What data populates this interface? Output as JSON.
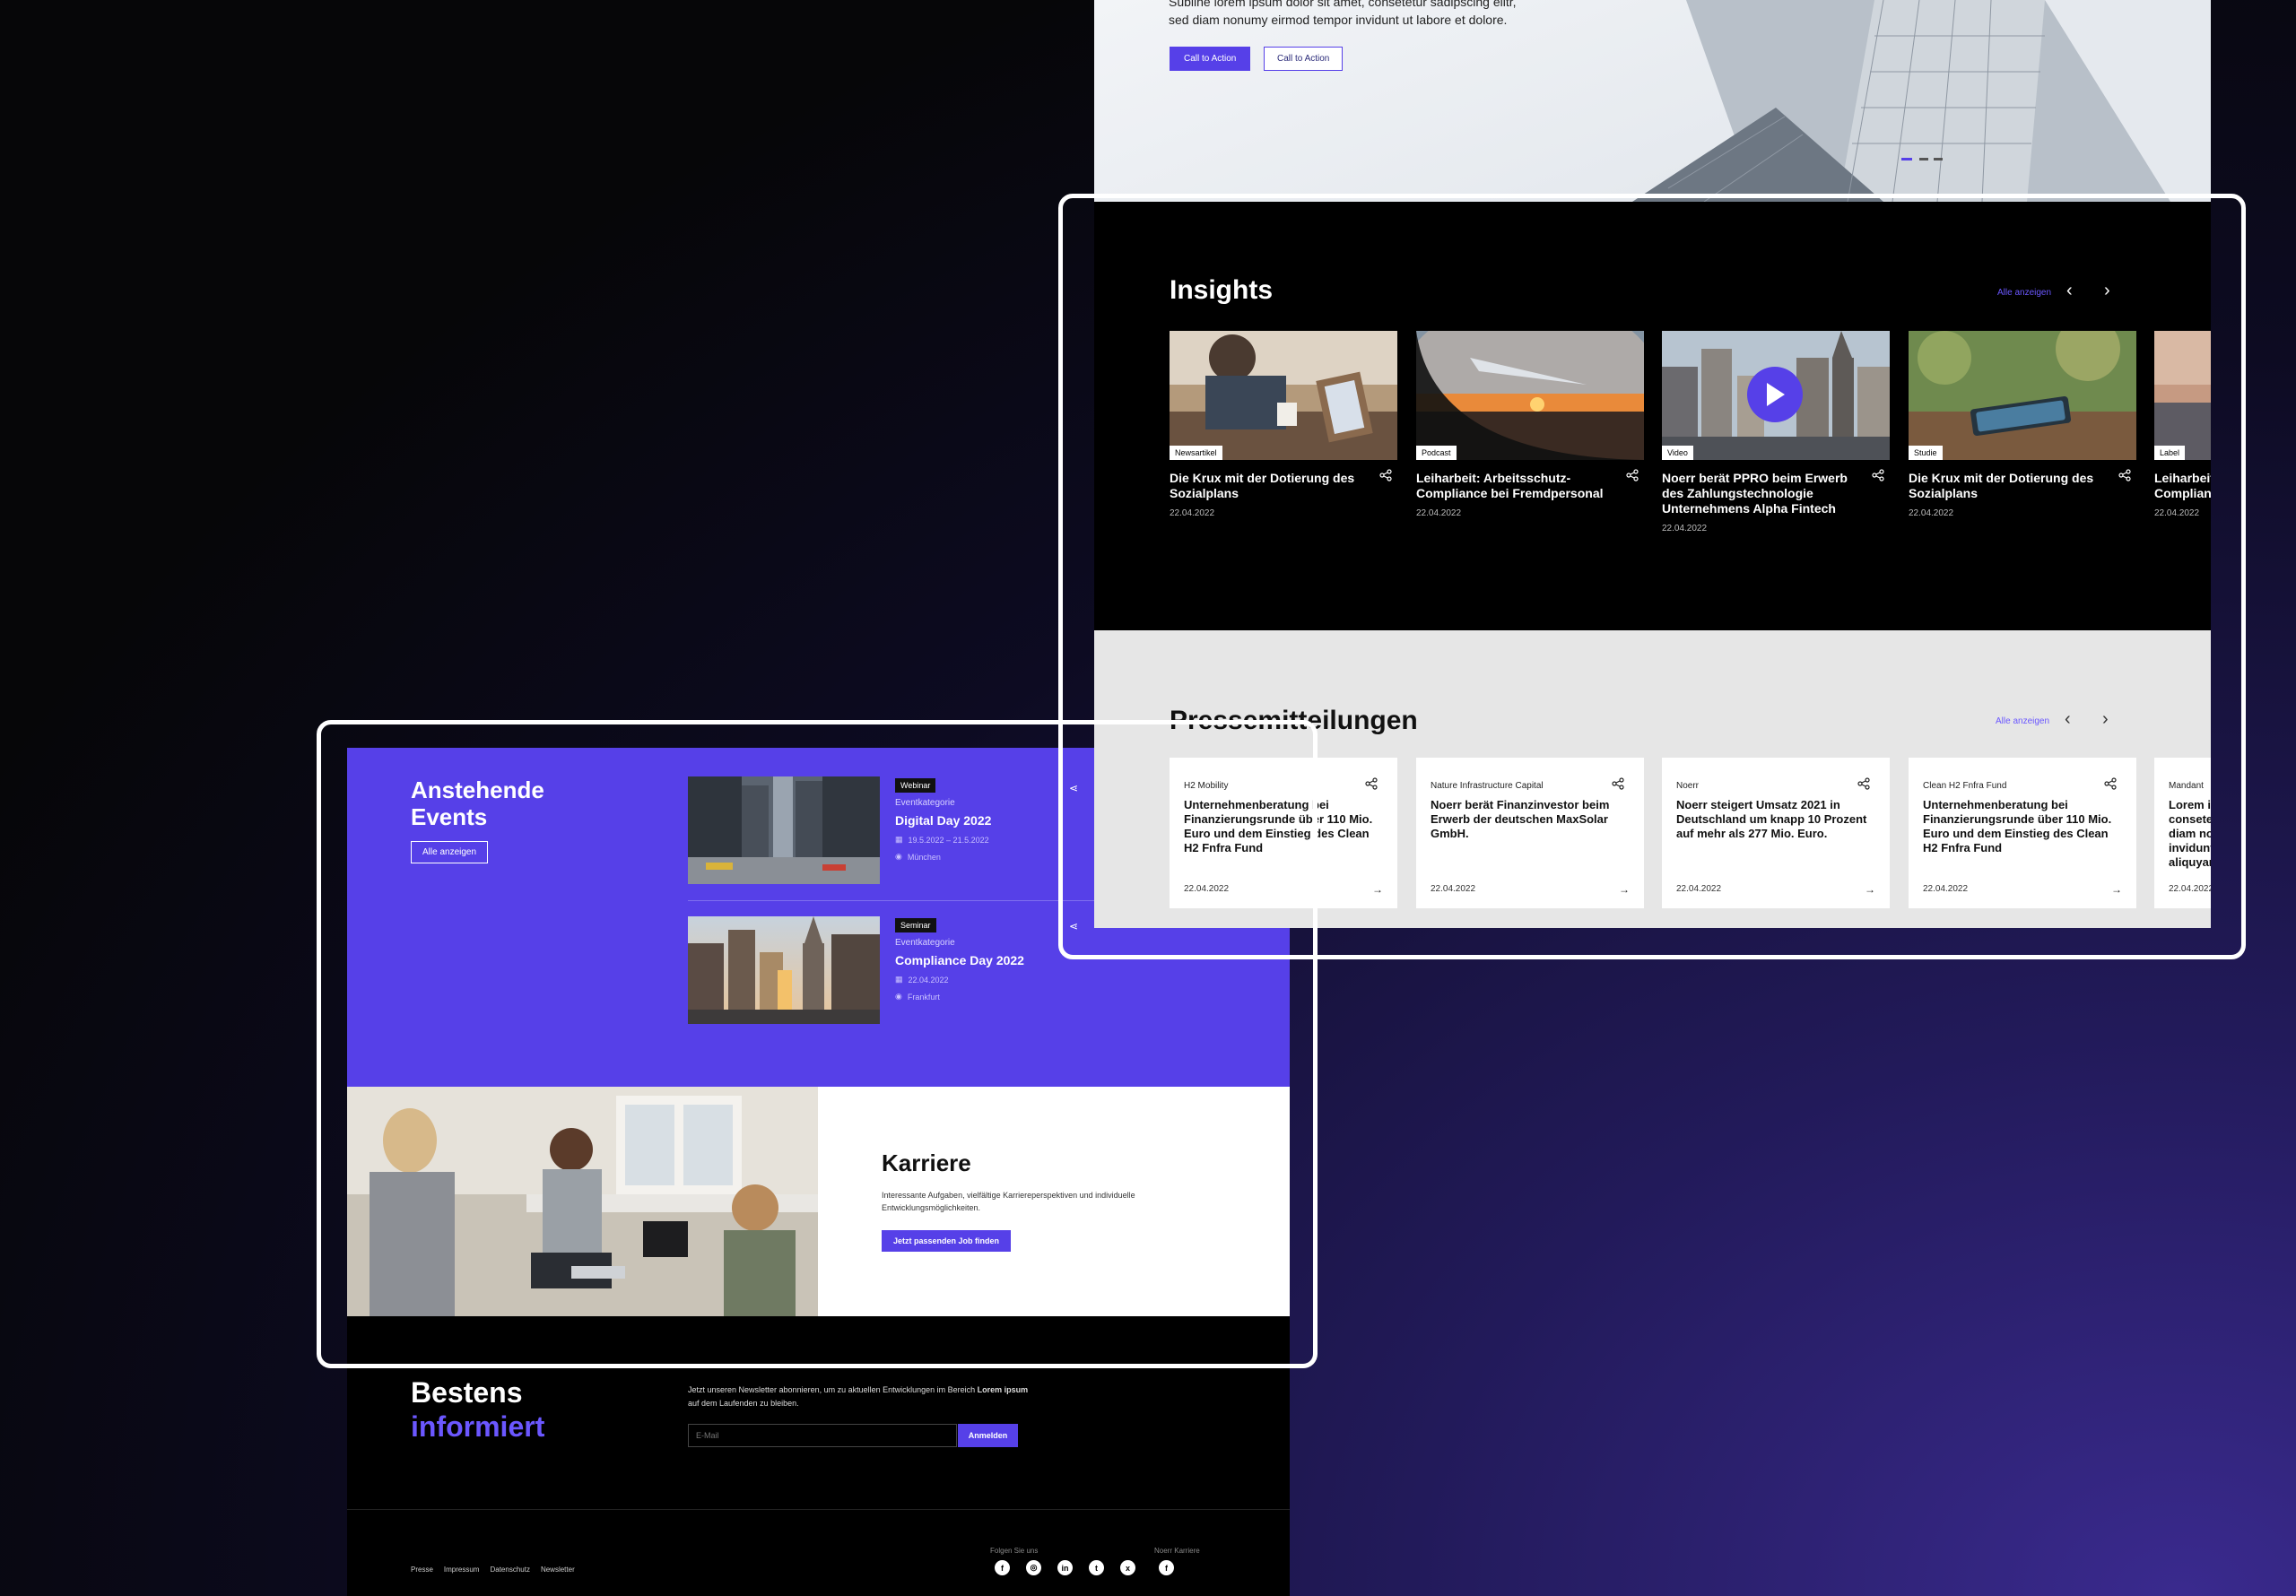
{
  "hero": {
    "text_line1": "Subline lorem ipsum dolor sit amet, consetetur sadipscing elitr,",
    "text_line2": "sed diam nonumy eirmod tempor invidunt ut labore et dolore.",
    "cta_primary": "Call to Action",
    "cta_secondary": "Call to Action"
  },
  "insights": {
    "title": "Insights",
    "all_link": "Alle anzeigen",
    "cards": [
      {
        "tag": "Newsartikel",
        "title": "Die Krux mit der Dotierung des Sozialplans",
        "date": "22.04.2022"
      },
      {
        "tag": "Podcast",
        "title": "Leiharbeit: Arbeitsschutz-Compliance bei Fremdpersonal",
        "date": "22.04.2022"
      },
      {
        "tag": "Video",
        "title": "Noerr berät PPRO beim Erwerb des Zahlungstechnologie Unternehmens Alpha Fintech",
        "date": "22.04.2022"
      },
      {
        "tag": "Studie",
        "title": "Die Krux mit der Dotierung des Sozialplans",
        "date": "22.04.2022"
      },
      {
        "tag": "Label",
        "title": "Leiharbeit: Arbeitsschutz-Compliance bei Fremdpersonal",
        "date": "22.04.2022"
      }
    ]
  },
  "presse": {
    "title": "Pressemitteilungen",
    "all_link": "Alle anzeigen",
    "cards": [
      {
        "source": "H2 Mobility",
        "title": "Unternehmenberatung bei Finanzierungsrunde über 110 Mio. Euro und dem Einstieg des Clean H2 Fnfra Fund",
        "date": "22.04.2022"
      },
      {
        "source": "Nature Infrastructure Capital",
        "title": "Noerr berät Finanzinvestor beim Erwerb der deutschen MaxSolar GmbH.",
        "date": "22.04.2022"
      },
      {
        "source": "Noerr",
        "title": "Noerr steigert Umsatz 2021 in Deutschland um knapp 10 Prozent auf mehr als 277 Mio. Euro.",
        "date": "22.04.2022"
      },
      {
        "source": "Clean H2 Fnfra Fund",
        "title": "Unternehmenberatung bei Finanzierungsrunde über 110 Mio. Euro und dem Einstieg des Clean H2 Fnfra Fund",
        "date": "22.04.2022"
      },
      {
        "source": "Mandant",
        "title": "Lorem ipsum dolor sit amet, consetetur sadipscing elitr, sed diam nonumy eirmod tempor invidunt ut labore et dolore magna aliquyam",
        "date": "22.04.2022"
      }
    ]
  },
  "events": {
    "title_line1": "Anstehende",
    "title_line2": "Events",
    "all_button": "Alle anzeigen",
    "items": [
      {
        "badge": "Webinar",
        "category": "Eventkategorie",
        "name": "Digital Day 2022",
        "date": "19.5.2022 – 21.5.2022",
        "location": "München"
      },
      {
        "badge": "Seminar",
        "category": "Eventkategorie",
        "name": "Compliance Day 2022",
        "date": "22.04.2022",
        "location": "Frankfurt"
      }
    ]
  },
  "karriere": {
    "title": "Karriere",
    "text": "Interessante Aufgaben, vielfältige Karriereperspektiven und individuelle Entwicklungsmöglichkeiten.",
    "button": "Jetzt passenden Job finden"
  },
  "newsletter": {
    "title_line1": "Bestens",
    "title_line2": "informiert",
    "text_pre": "Jetzt unseren Newsletter abonnieren, um zu aktuellen Entwicklungen im Bereich ",
    "text_bold": "Lorem ipsum",
    "text_post": "auf dem Laufenden zu bleiben.",
    "input_placeholder": "E-Mail",
    "button": "Anmelden"
  },
  "footer": {
    "links": [
      "Presse",
      "Impressum",
      "Datenschutz",
      "Newsletter"
    ],
    "follow_label": "Folgen Sie uns",
    "career_label": "Noerr Karriere",
    "social_icons": [
      "facebook-icon",
      "instagram-icon",
      "linkedin-icon",
      "twitter-icon",
      "xing-icon"
    ],
    "career_icons": [
      "facebook-icon"
    ]
  },
  "colors": {
    "accent": "#5640e8",
    "accent_text": "#6b57ff",
    "presse_bg": "#e6e6e6"
  }
}
